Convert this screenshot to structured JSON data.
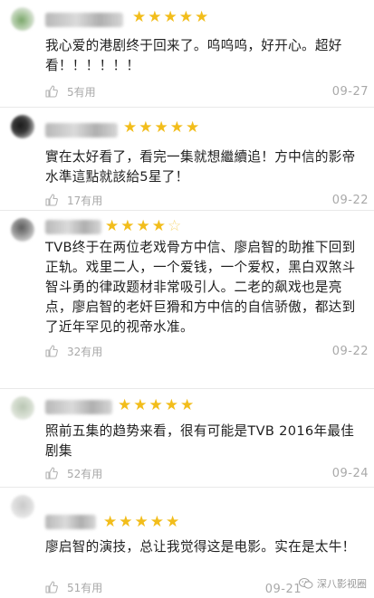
{
  "colors": {
    "star": "#f2bd1b",
    "meta_text": "#a9a9a9",
    "divider": "#e9e9e9"
  },
  "icons": {
    "like": "thumbs-up-icon",
    "star": "star-icon",
    "watermark": "wechat-icon"
  },
  "reviews": [
    {
      "rating": 5,
      "text": "我心爱的港剧终于回来了。呜呜呜，好开心。超好看！！！！！！",
      "likes": "5有用",
      "date": "09-27"
    },
    {
      "rating": 5,
      "text": "實在太好看了，看完一集就想繼續追！方中信的影帝水準這點就該給5星了！",
      "likes": "17有用",
      "date": "09-22"
    },
    {
      "rating": 4,
      "text": "TVB终于在两位老戏骨方中信、廖启智的助推下回到正轨。戏里二人，一个爱钱，一个爱权，黑白双煞斗智斗勇的律政题材非常吸引人。二老的飙戏也是亮点，廖启智的老奸巨猾和方中信的自信骄傲，都达到了近年罕见的视帝水准。",
      "likes": "32有用",
      "date": "09-22"
    },
    {
      "rating": 5,
      "text": "照前五集的趋势来看，很有可能是TVB 2016年最佳剧集",
      "likes": "52有用",
      "date": "09-24"
    },
    {
      "rating": 5,
      "text": "廖启智的演技，总让我觉得这是电影。实在是太牛！",
      "likes": "51有用",
      "date": "09-21"
    }
  ],
  "watermark": {
    "text": "深八影视圈"
  }
}
